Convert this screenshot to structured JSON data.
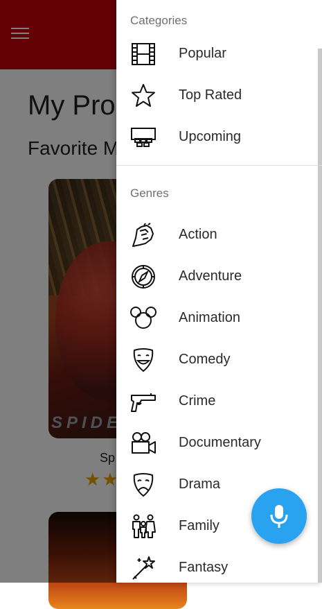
{
  "background": {
    "title": "My Pro",
    "subtitle": "Favorite M",
    "movie_title": "Sp",
    "poster_logo": "SPIDE",
    "rating_stars": "★★"
  },
  "drawer": {
    "categories_header": "Categories",
    "categories": [
      {
        "label": "Popular",
        "icon": "film-strip-icon"
      },
      {
        "label": "Top Rated",
        "icon": "star-icon"
      },
      {
        "label": "Upcoming",
        "icon": "theater-icon"
      }
    ],
    "genres_header": "Genres",
    "genres": [
      {
        "label": "Action",
        "icon": "fist-icon"
      },
      {
        "label": "Adventure",
        "icon": "compass-icon"
      },
      {
        "label": "Animation",
        "icon": "mouse-ears-icon"
      },
      {
        "label": "Comedy",
        "icon": "comedy-mask-icon"
      },
      {
        "label": "Crime",
        "icon": "pistol-icon"
      },
      {
        "label": "Documentary",
        "icon": "movie-camera-icon"
      },
      {
        "label": "Drama",
        "icon": "drama-mask-icon"
      },
      {
        "label": "Family",
        "icon": "family-icon"
      },
      {
        "label": "Fantasy",
        "icon": "magic-wand-icon"
      }
    ]
  },
  "colors": {
    "app_bar": "#c4000b",
    "fab": "#29a3f0",
    "star": "#e6a200"
  },
  "fab": {
    "icon": "microphone-icon"
  }
}
